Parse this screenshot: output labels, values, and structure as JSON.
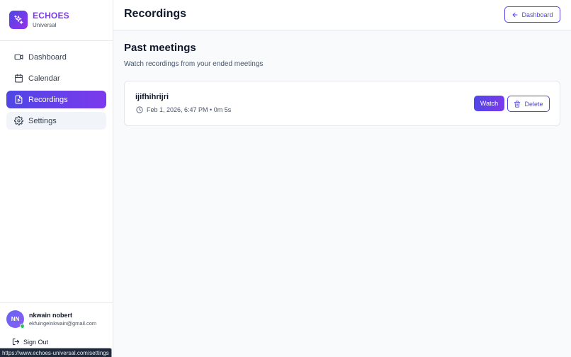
{
  "brand": {
    "name": "ECHOES",
    "subtitle": "Universal"
  },
  "sidebar": {
    "items": [
      {
        "label": "Dashboard",
        "icon": "video-camera-icon",
        "active": false
      },
      {
        "label": "Calendar",
        "icon": "calendar-icon",
        "active": false
      },
      {
        "label": "Recordings",
        "icon": "file-video-icon",
        "active": true
      },
      {
        "label": "Settings",
        "icon": "gear-icon",
        "active": false
      }
    ]
  },
  "user": {
    "initials": "NN",
    "name": "nkwain nobert",
    "email": "ekfuingeinkwain@gmail.com",
    "status": "online"
  },
  "signout_label": "Sign Out",
  "status_url": "https://www.echoes-universal.com/settings",
  "header": {
    "title": "Recordings",
    "back_label": "Dashboard"
  },
  "main": {
    "title": "Past meetings",
    "subtitle": "Watch recordings from your ended meetings",
    "recordings": [
      {
        "title": "ijifhihrijri",
        "meta": "Feb 1, 2026, 6:47 PM • 0m 5s",
        "watch_label": "Watch",
        "delete_label": "Delete"
      }
    ]
  },
  "colors": {
    "accent": "#4f46e5",
    "accent_end": "#7c3aed",
    "online": "#22c55e"
  }
}
